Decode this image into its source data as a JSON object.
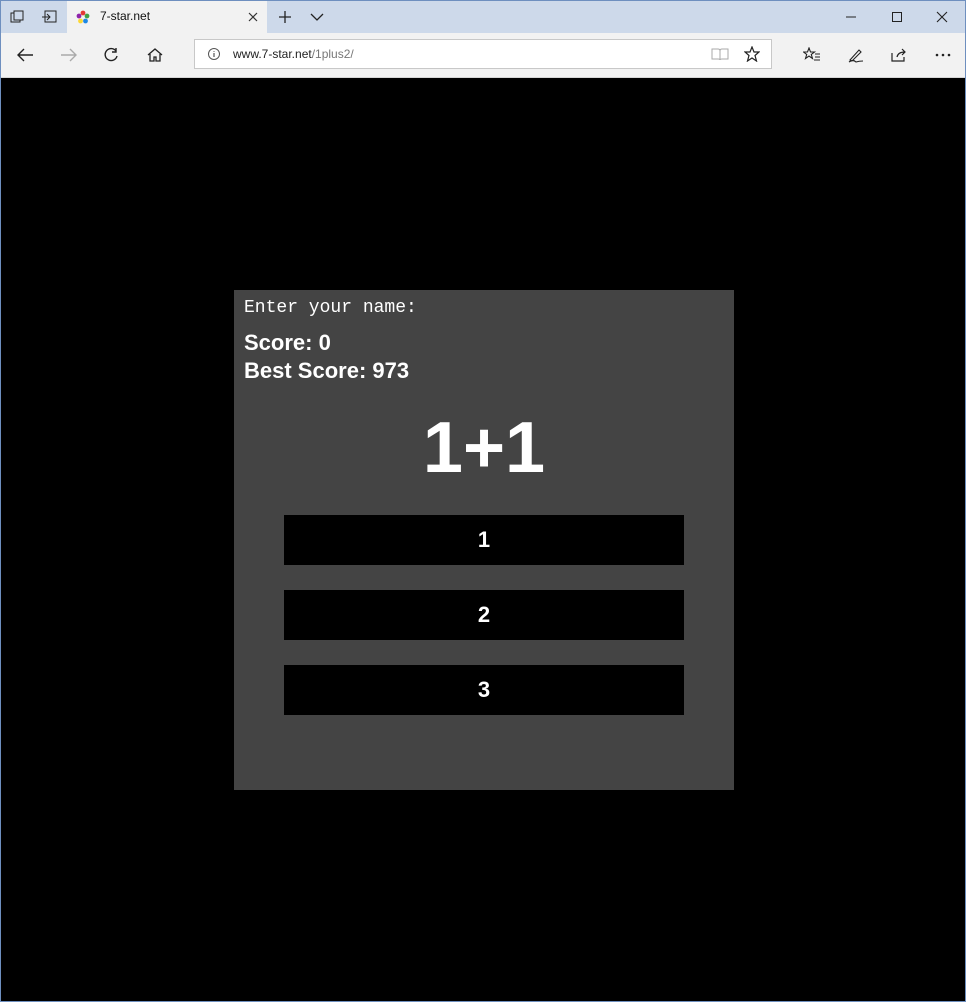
{
  "browser": {
    "tab_title": "7-star.net",
    "url_domain": "www.7-star.net",
    "url_path": "/1plus2/"
  },
  "game": {
    "name_label": "Enter your name:",
    "score_label": "Score: 0",
    "best_label": "Best Score: 973",
    "question": "1+1",
    "answers": [
      "1",
      "2",
      "3"
    ]
  },
  "colors": {
    "page_background": "#000000",
    "panel_background": "#444444",
    "button_background": "#000000",
    "text": "#ffffff"
  }
}
